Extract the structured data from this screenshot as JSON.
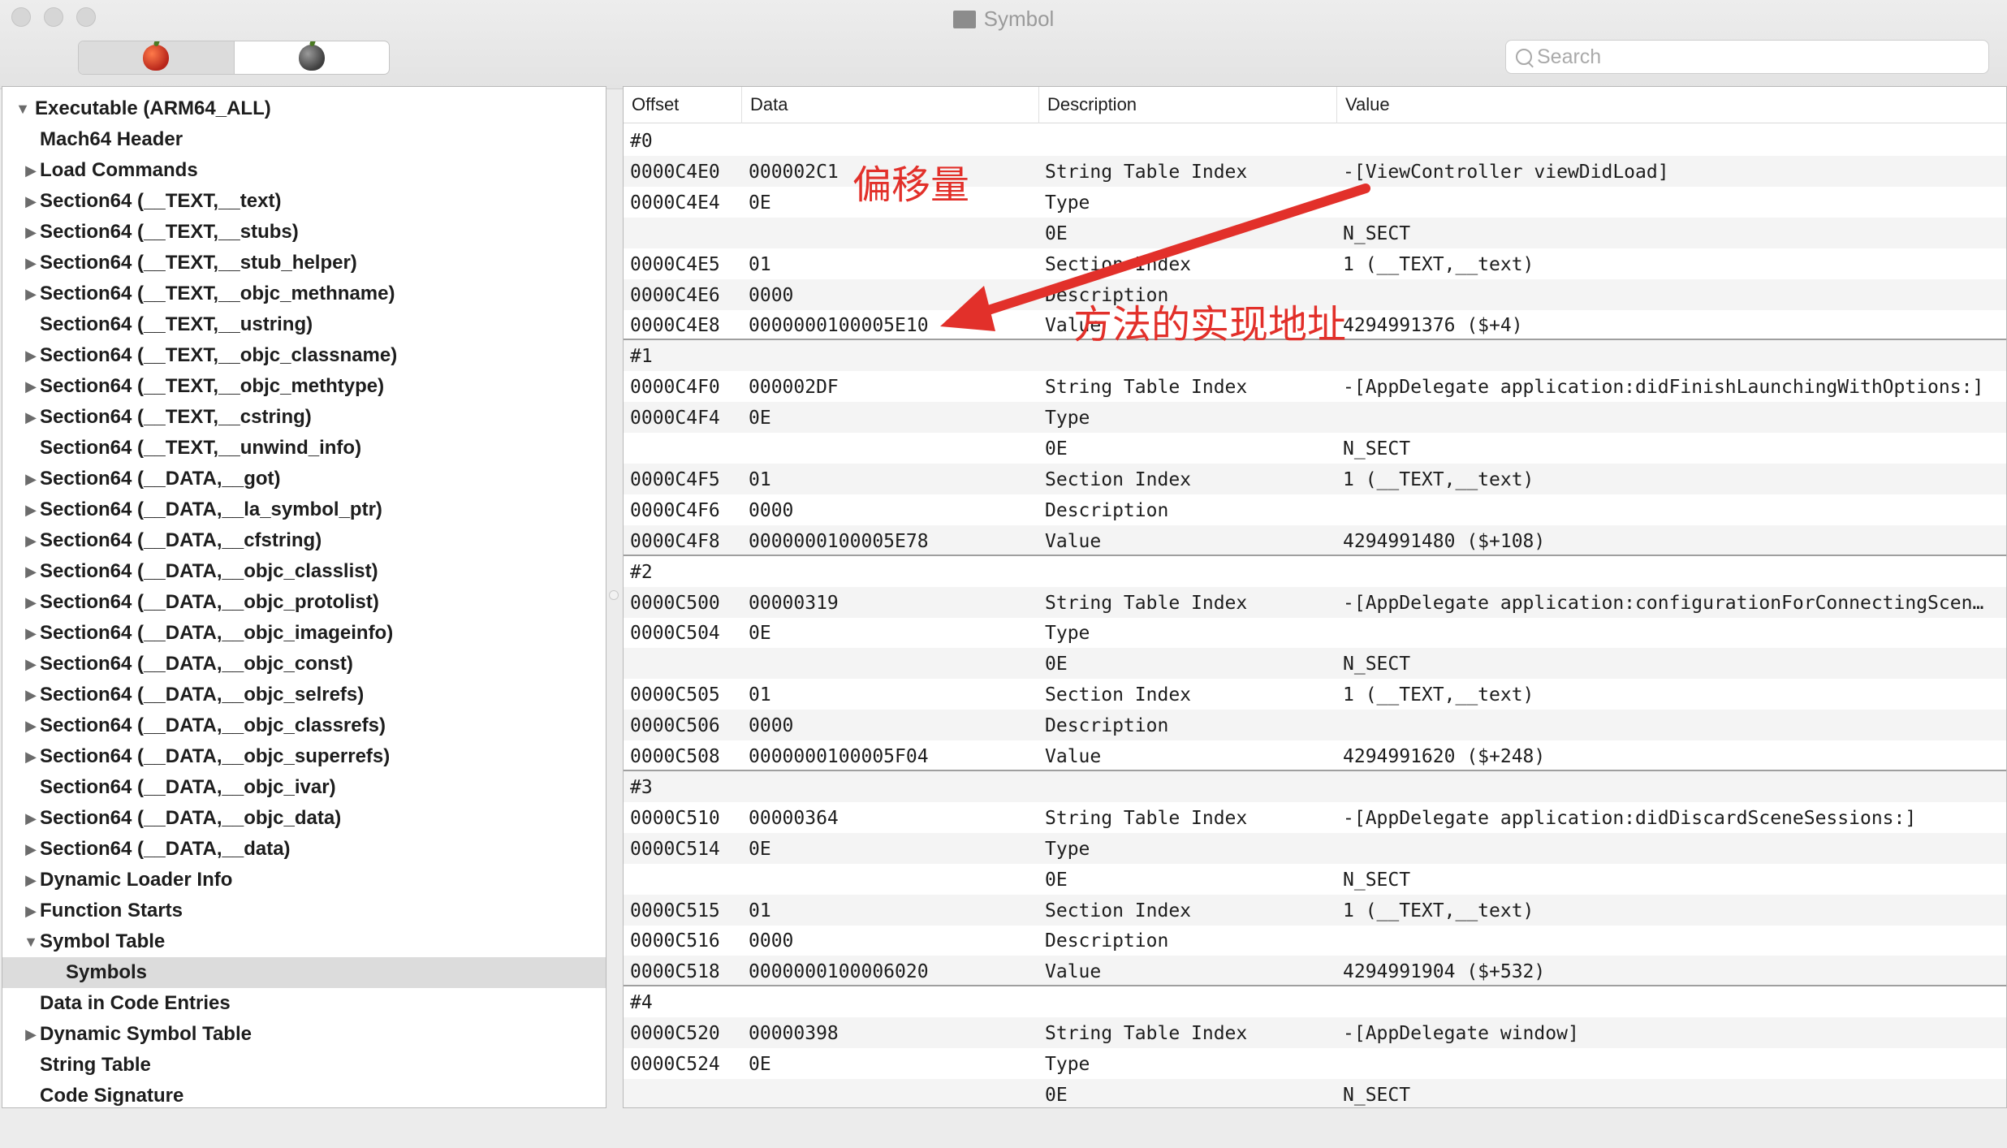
{
  "window": {
    "title": "Symbol"
  },
  "toolbar": {
    "search_placeholder": "Search",
    "mode_left": "raw-mode-icon",
    "mode_right": "rva-mode-icon"
  },
  "tree": [
    {
      "label": "Executable  (ARM64_ALL)",
      "level": 0,
      "disclosure": "open"
    },
    {
      "label": "Mach64 Header",
      "level": 1,
      "disclosure": "none"
    },
    {
      "label": "Load Commands",
      "level": 1,
      "disclosure": "closed"
    },
    {
      "label": "Section64 (__TEXT,__text)",
      "level": 1,
      "disclosure": "closed"
    },
    {
      "label": "Section64 (__TEXT,__stubs)",
      "level": 1,
      "disclosure": "closed"
    },
    {
      "label": "Section64 (__TEXT,__stub_helper)",
      "level": 1,
      "disclosure": "closed"
    },
    {
      "label": "Section64 (__TEXT,__objc_methname)",
      "level": 1,
      "disclosure": "closed"
    },
    {
      "label": "Section64 (__TEXT,__ustring)",
      "level": 1,
      "disclosure": "none"
    },
    {
      "label": "Section64 (__TEXT,__objc_classname)",
      "level": 1,
      "disclosure": "closed"
    },
    {
      "label": "Section64 (__TEXT,__objc_methtype)",
      "level": 1,
      "disclosure": "closed"
    },
    {
      "label": "Section64 (__TEXT,__cstring)",
      "level": 1,
      "disclosure": "closed"
    },
    {
      "label": "Section64 (__TEXT,__unwind_info)",
      "level": 1,
      "disclosure": "none"
    },
    {
      "label": "Section64 (__DATA,__got)",
      "level": 1,
      "disclosure": "closed"
    },
    {
      "label": "Section64 (__DATA,__la_symbol_ptr)",
      "level": 1,
      "disclosure": "closed"
    },
    {
      "label": "Section64 (__DATA,__cfstring)",
      "level": 1,
      "disclosure": "closed"
    },
    {
      "label": "Section64 (__DATA,__objc_classlist)",
      "level": 1,
      "disclosure": "closed"
    },
    {
      "label": "Section64 (__DATA,__objc_protolist)",
      "level": 1,
      "disclosure": "closed"
    },
    {
      "label": "Section64 (__DATA,__objc_imageinfo)",
      "level": 1,
      "disclosure": "closed"
    },
    {
      "label": "Section64 (__DATA,__objc_const)",
      "level": 1,
      "disclosure": "closed"
    },
    {
      "label": "Section64 (__DATA,__objc_selrefs)",
      "level": 1,
      "disclosure": "closed"
    },
    {
      "label": "Section64 (__DATA,__objc_classrefs)",
      "level": 1,
      "disclosure": "closed"
    },
    {
      "label": "Section64 (__DATA,__objc_superrefs)",
      "level": 1,
      "disclosure": "closed"
    },
    {
      "label": "Section64 (__DATA,__objc_ivar)",
      "level": 1,
      "disclosure": "none"
    },
    {
      "label": "Section64 (__DATA,__objc_data)",
      "level": 1,
      "disclosure": "closed"
    },
    {
      "label": "Section64 (__DATA,__data)",
      "level": 1,
      "disclosure": "closed"
    },
    {
      "label": "Dynamic Loader Info",
      "level": 1,
      "disclosure": "closed"
    },
    {
      "label": "Function Starts",
      "level": 1,
      "disclosure": "closed"
    },
    {
      "label": "Symbol Table",
      "level": 1,
      "disclosure": "open"
    },
    {
      "label": "Symbols",
      "level": 2,
      "disclosure": "none",
      "selected": true
    },
    {
      "label": "Data in Code Entries",
      "level": 1,
      "disclosure": "none"
    },
    {
      "label": "Dynamic Symbol Table",
      "level": 1,
      "disclosure": "closed"
    },
    {
      "label": "String Table",
      "level": 1,
      "disclosure": "none"
    },
    {
      "label": "Code Signature",
      "level": 1,
      "disclosure": "none"
    }
  ],
  "table": {
    "columns": [
      "Offset",
      "Data",
      "Description",
      "Value"
    ],
    "rows": [
      [
        "#0",
        "",
        "",
        ""
      ],
      [
        "0000C4E0",
        "000002C1",
        "String Table Index",
        "-[ViewController viewDidLoad]"
      ],
      [
        "0000C4E4",
        "0E",
        "Type",
        ""
      ],
      [
        "",
        "",
        "0E",
        "N_SECT"
      ],
      [
        "0000C4E5",
        "01",
        "Section Index",
        "1 (__TEXT,__text)"
      ],
      [
        "0000C4E6",
        "0000",
        "Description",
        ""
      ],
      [
        "0000C4E8",
        "0000000100005E10",
        "Value",
        "4294991376 ($+4)"
      ],
      [
        "#1",
        "",
        "",
        ""
      ],
      [
        "0000C4F0",
        "000002DF",
        "String Table Index",
        "-[AppDelegate application:didFinishLaunchingWithOptions:]"
      ],
      [
        "0000C4F4",
        "0E",
        "Type",
        ""
      ],
      [
        "",
        "",
        "0E",
        "N_SECT"
      ],
      [
        "0000C4F5",
        "01",
        "Section Index",
        "1 (__TEXT,__text)"
      ],
      [
        "0000C4F6",
        "0000",
        "Description",
        ""
      ],
      [
        "0000C4F8",
        "0000000100005E78",
        "Value",
        "4294991480 ($+108)"
      ],
      [
        "#2",
        "",
        "",
        ""
      ],
      [
        "0000C500",
        "00000319",
        "String Table Index",
        "-[AppDelegate application:configurationForConnectingSceneSession:options:]"
      ],
      [
        "0000C504",
        "0E",
        "Type",
        ""
      ],
      [
        "",
        "",
        "0E",
        "N_SECT"
      ],
      [
        "0000C505",
        "01",
        "Section Index",
        "1 (__TEXT,__text)"
      ],
      [
        "0000C506",
        "0000",
        "Description",
        ""
      ],
      [
        "0000C508",
        "0000000100005F04",
        "Value",
        "4294991620 ($+248)"
      ],
      [
        "#3",
        "",
        "",
        ""
      ],
      [
        "0000C510",
        "00000364",
        "String Table Index",
        "-[AppDelegate application:didDiscardSceneSessions:]"
      ],
      [
        "0000C514",
        "0E",
        "Type",
        ""
      ],
      [
        "",
        "",
        "0E",
        "N_SECT"
      ],
      [
        "0000C515",
        "01",
        "Section Index",
        "1 (__TEXT,__text)"
      ],
      [
        "0000C516",
        "0000",
        "Description",
        ""
      ],
      [
        "0000C518",
        "0000000100006020",
        "Value",
        "4294991904 ($+532)"
      ],
      [
        "#4",
        "",
        "",
        ""
      ],
      [
        "0000C520",
        "00000398",
        "String Table Index",
        "-[AppDelegate window]"
      ],
      [
        "0000C524",
        "0E",
        "Type",
        ""
      ],
      [
        "",
        "",
        "0E",
        "N_SECT"
      ]
    ]
  },
  "annotations": {
    "offset_label": "偏移量",
    "impl_label": "方法的实现地址",
    "color": "#e2302a"
  }
}
